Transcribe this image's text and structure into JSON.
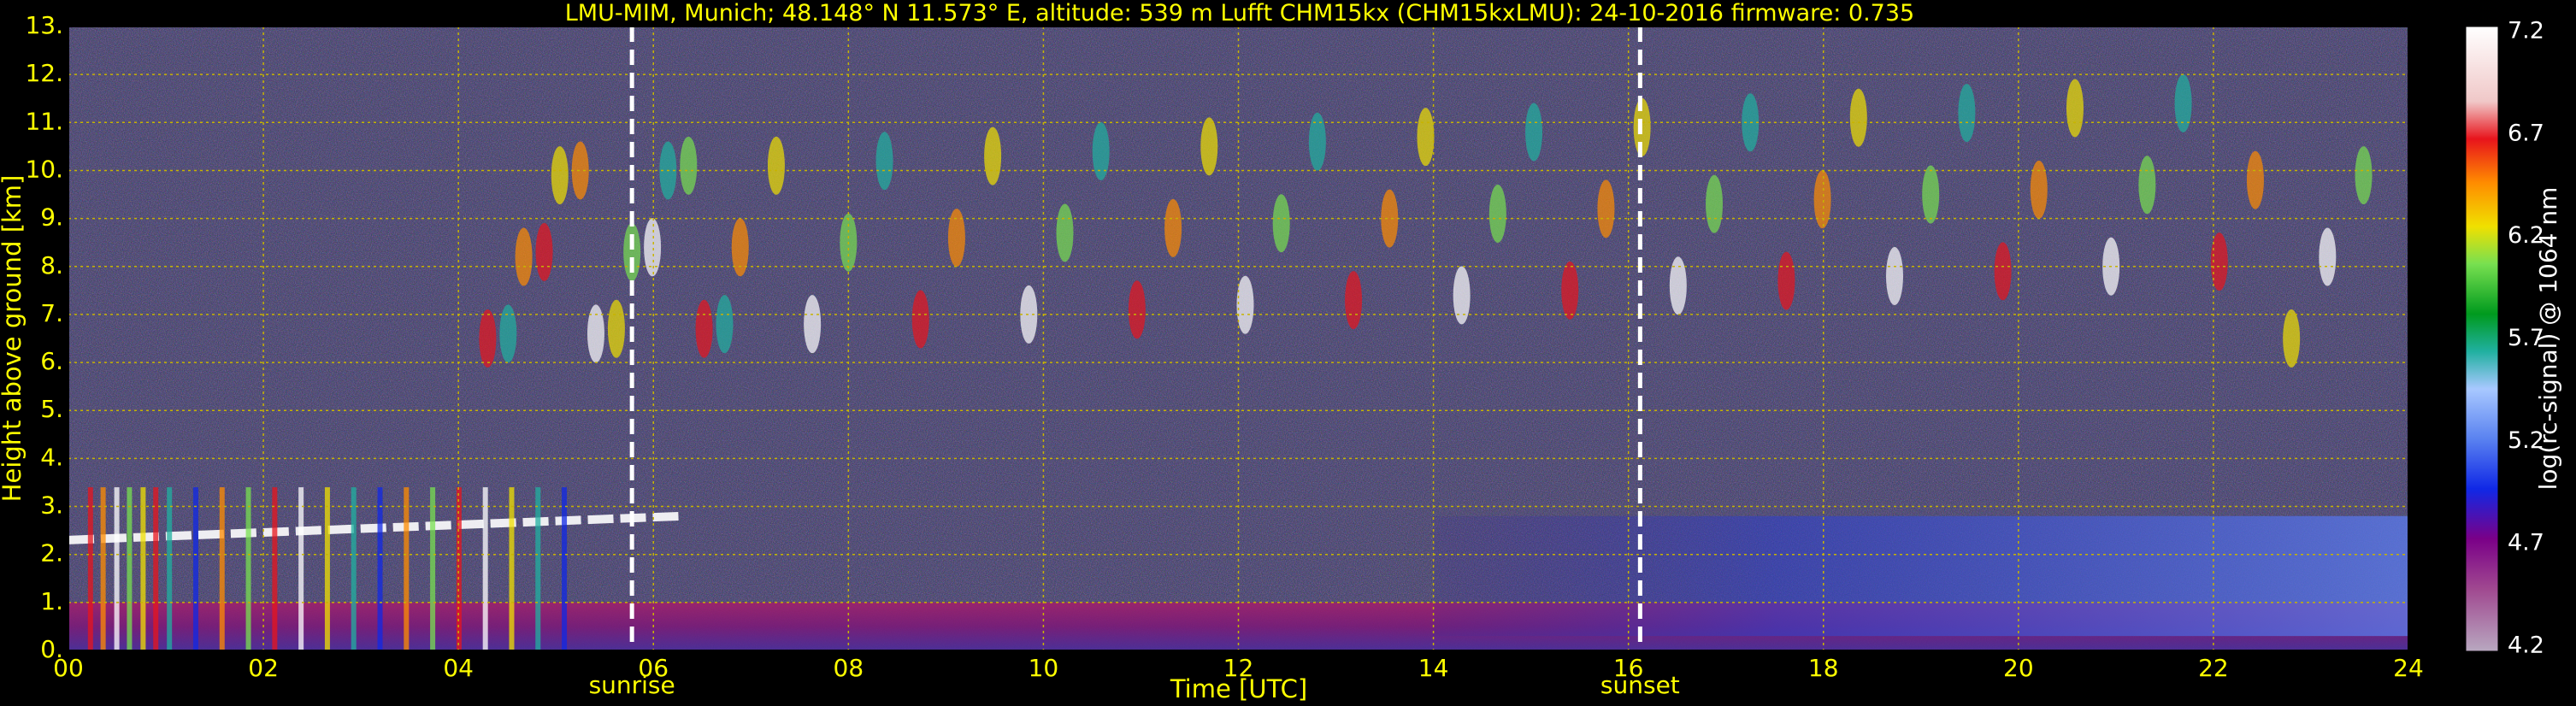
{
  "chart_data": {
    "type": "heatmap",
    "title": "LMU-MIM, Munich; 48.148° N 11.573° E, altitude: 539 m     Lufft CHM15kx (CHM15kxLMU): 24-10-2016     firmware: 0.735",
    "xlabel": "Time [UTC]",
    "ylabel": "Height above ground [km]",
    "xlim": [
      0,
      24
    ],
    "ylim": [
      0,
      13
    ],
    "x_ticks": [
      "00",
      "02",
      "04",
      "06",
      "08",
      "10",
      "12",
      "14",
      "16",
      "18",
      "20",
      "22",
      "24"
    ],
    "y_ticks": [
      "0.",
      "1.",
      "2.",
      "3.",
      "4.",
      "5.",
      "6.",
      "7.",
      "8.",
      "9.",
      "10.",
      "11.",
      "12.",
      "13."
    ],
    "grid": true,
    "annotations": [
      {
        "label": "sunrise",
        "x": 5.78
      },
      {
        "label": "sunset",
        "x": 16.12
      }
    ],
    "colorbar": {
      "label": "log(rc-signal) @ 1064 nm",
      "range": [
        4.2,
        7.2
      ],
      "ticks": [
        "7.2",
        "6.7",
        "6.2",
        "5.7",
        "5.2",
        "4.7",
        "4.2"
      ]
    },
    "features": [
      {
        "name": "boundary layer aerosol",
        "x": [
          0,
          24
        ],
        "y": [
          0,
          1.0
        ]
      },
      {
        "name": "low cloud",
        "x": [
          0,
          6.3
        ],
        "y": [
          1.0,
          3.6
        ],
        "base_km": 3.0
      },
      {
        "name": "cirrus",
        "x": [
          4.3,
          24
        ],
        "y": [
          6.0,
          12.0
        ]
      },
      {
        "name": "residual aerosol layer",
        "x": [
          14,
          24
        ],
        "y": [
          0.3,
          2.8
        ]
      }
    ]
  },
  "colors": {
    "text": "#ffff00",
    "grid": "#c8b400",
    "background_noise": "#3c3470",
    "marker": "#ffffff"
  }
}
